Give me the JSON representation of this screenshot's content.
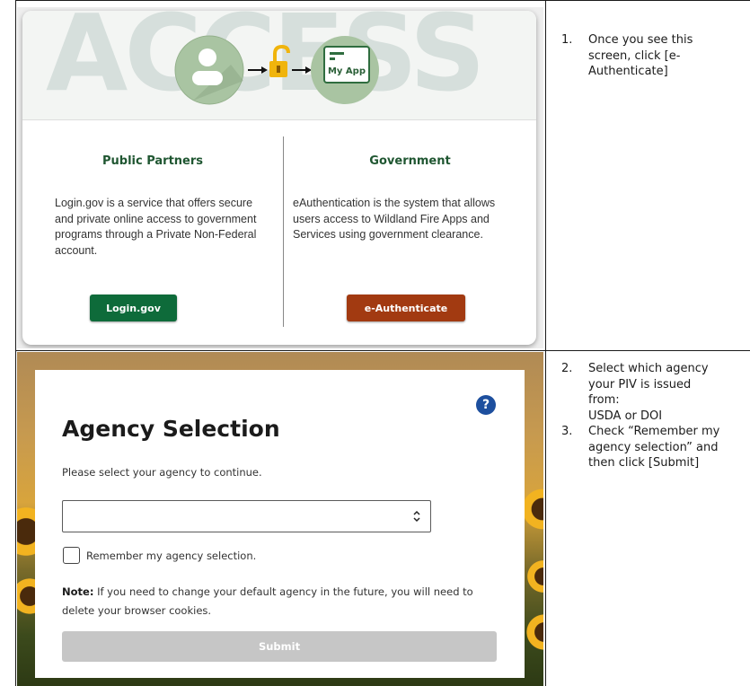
{
  "top_screen": {
    "watermark": "ACCESS",
    "myapp_label": "My App",
    "public_partners": {
      "title": "Public Partners",
      "description": "Login.gov is a service that offers secure and private online access to government programs through a Private Non-Federal account.",
      "button": "Login.gov"
    },
    "government": {
      "title": "Government",
      "description": "eAuthentication is the system that allows users access to Wildland Fire Apps and Services using government clearance.",
      "button": "e-Authenticate"
    },
    "colors": {
      "green": "#0e6b3a",
      "orange": "#a23a11",
      "lock": "#f0b40c"
    }
  },
  "bottom_screen": {
    "title": "Agency Selection",
    "help_icon": "question-circle-icon",
    "instruction": "Please select your agency to continue.",
    "select_value": "",
    "remember_label": "Remember my agency selection.",
    "remember_checked": false,
    "note_label": "Note:",
    "note_text": " If you need to change your default agency in the future, you will need to delete your browser cookies.",
    "submit": "Submit"
  },
  "steps": [
    {
      "num": "1.",
      "lines": [
        "Once you see this",
        "screen, click [e-",
        "Authenticate]"
      ]
    },
    {
      "num": "2.",
      "lines": [
        "Select which agency",
        "your PIV is issued",
        "from:",
        "USDA or DOI"
      ]
    },
    {
      "num": "3.",
      "lines": [
        "Check “Remember my",
        "agency selection” and",
        "then click [Submit]"
      ]
    }
  ]
}
